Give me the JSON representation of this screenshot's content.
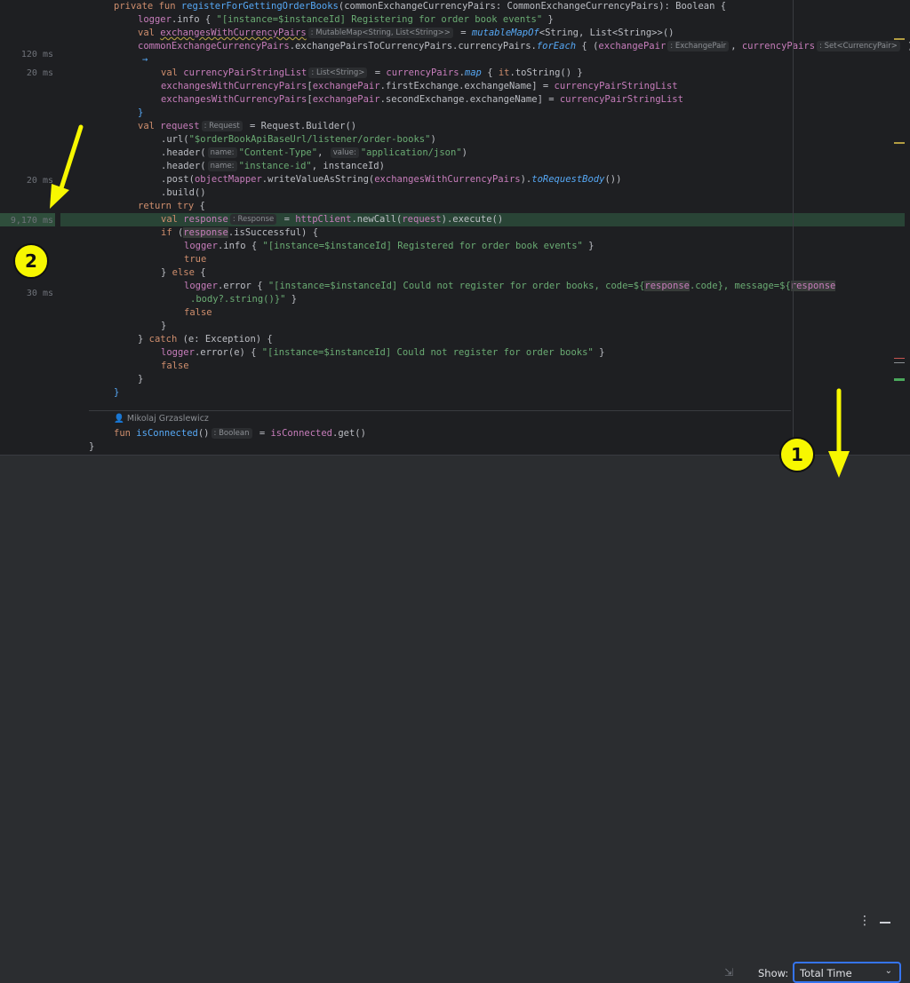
{
  "gutter": {
    "times": [
      "120 ms",
      "20 ms",
      "20 ms",
      "9,170 ms",
      "30 ms"
    ]
  },
  "code": {
    "l1a": "private fun ",
    "l1b": "registerForGettingOrderBooks",
    "l1c": "(commonExchangeCurrencyPairs: CommonExchangeCurrencyPairs): Boolean {",
    "l2a": "logger",
    "l2b": ".info { ",
    "l2c": "\"[instance=$instanceId] Registering for order book events\"",
    "l2d": " }",
    "l3a": "val ",
    "l3b": "exchangesWithCurrencyPairs",
    "l3h": ": MutableMap<String, List<String>>",
    "l3c": " = ",
    "l3d": "mutableMapOf",
    "l3e": "<String, List<String>>()",
    "l4a": "commonExchangeCurrencyPairs",
    "l4b": ".exchangePairsToCurrencyPairs",
    "l4c": ".currencyPairs.",
    "l4d": "forEach",
    "l4e": " { (",
    "l4f": "exchangePair",
    "l4h": ": ExchangePair",
    "l4g": ", ",
    "l4i": "currencyPairs",
    "l4j": ": Set<CurrencyPair>",
    "l4k": " )",
    "l5a": "→",
    "l6a": "val ",
    "l6b": "currencyPairStringList",
    "l6h": ": List<String>",
    "l6c": " = ",
    "l6d": "currencyPairs",
    "l6e": ".",
    "l6f": "map",
    "l6g": " { ",
    "l6i": "it",
    "l6j": ".toString() }",
    "l7a": "exchangesWithCurrencyPairs",
    "l7b": "[",
    "l7c": "exchangePair",
    "l7d": ".firstExchange.exchangeName] = ",
    "l7e": "currencyPairStringList",
    "l8a": "exchangesWithCurrencyPairs",
    "l8b": "[",
    "l8c": "exchangePair",
    "l8d": ".secondExchange.exchangeName] = ",
    "l8e": "currencyPairStringList",
    "l9a": "}",
    "l10a": "val ",
    "l10b": "request",
    "l10h": ": Request",
    "l10c": " = Request.Builder()",
    "l11a": ".url(",
    "l11b": "\"$orderBookApiBaseUrl/listener/order-books\"",
    "l11c": ")",
    "l12a": ".header(",
    "l12h": "name:",
    "l12b": "\"Content-Type\"",
    "l12c": ", ",
    "l12i": "value:",
    "l12d": "\"application/json\"",
    "l12e": ")",
    "l13a": ".header(",
    "l13h": "name:",
    "l13b": "\"instance-id\"",
    "l13c": ", instanceId)",
    "l14a": ".post(",
    "l14b": "objectMapper",
    "l14c": ".writeValueAsString(",
    "l14d": "exchangesWithCurrencyPairs",
    "l14e": ").",
    "l14f": "toRequestBody",
    "l14g": "())",
    "l15a": ".build()",
    "l16a": "return try",
    "l16b": " {",
    "l17a": "val ",
    "l17b": "response",
    "l17h": ": Response",
    "l17c": " = ",
    "l17d": "httpClient",
    "l17e": ".newCall(",
    "l17f": "request",
    "l17g": ").execute()",
    "l18a": "if ",
    "l18b": "(",
    "l18c": "response",
    "l18d": ".isSuccessful) {",
    "l19a": "logger",
    "l19b": ".info { ",
    "l19c": "\"[instance=$instanceId] Registered for order book events\"",
    "l19d": " }",
    "l20a": "true",
    "l21a": "} ",
    "l21b": "else",
    "l21c": " {",
    "l22a": "logger",
    "l22b": ".error { ",
    "l22c": "\"[instance=$instanceId] Could not register for order books, code=${",
    "l22d": "response",
    "l22e": ".code}",
    "l22f": ", message=${",
    "l22g": "response",
    "l23a": ".body?.string()}\"",
    "l23b": " }",
    "l24a": "false",
    "l25a": "}",
    "l26a": "} ",
    "l26b": "catch",
    "l26c": " (e: Exception) {",
    "l27a": "logger",
    "l27b": ".error(e) { ",
    "l27c": "\"[instance=$instanceId] Could not register for order books\"",
    "l27d": " }",
    "l28a": "false",
    "l29a": "}",
    "l30a": "}",
    "l31a": "fun ",
    "l31b": "isConnected",
    "l31c": "()",
    "l31h": ": Boolean",
    "l31d": " = ",
    "l31e": "isConnected",
    "l31f": ".get()",
    "l32a": "}"
  },
  "author": "👤 Mikolaj Grzaslewicz",
  "panel": {
    "show_label": "Show:",
    "show_value": "Total Time",
    "more_icon": "more-vertical-icon",
    "minimize_icon": "minimize-icon",
    "collapse_icon": "collapse-icon"
  },
  "annotations": {
    "badge1": "1",
    "badge2": "2"
  },
  "colors": {
    "highlight": "#294436",
    "accent": "#3574f0",
    "annotation": "#f7f700"
  }
}
